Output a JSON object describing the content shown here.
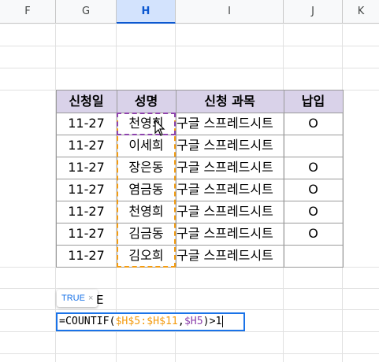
{
  "columns": [
    {
      "letter": "F",
      "selected": false
    },
    {
      "letter": "G",
      "selected": false
    },
    {
      "letter": "H",
      "selected": true
    },
    {
      "letter": "I",
      "selected": false
    },
    {
      "letter": "J",
      "selected": false
    },
    {
      "letter": "K",
      "selected": false
    }
  ],
  "table": {
    "headers": [
      "신청일",
      "성명",
      "신청 과목",
      "납입"
    ],
    "rows": [
      {
        "date": "11-27",
        "name": "천영희",
        "course": "구글 스프레드시트",
        "paid": "O"
      },
      {
        "date": "11-27",
        "name": "이세희",
        "course": "구글 스프레드시트",
        "paid": ""
      },
      {
        "date": "11-27",
        "name": "장은동",
        "course": "구글 스프레드시트",
        "paid": "O"
      },
      {
        "date": "11-27",
        "name": "염금동",
        "course": "구글 스프레드시트",
        "paid": "O"
      },
      {
        "date": "11-27",
        "name": "천영희",
        "course": "구글 스프레드시트",
        "paid": "O"
      },
      {
        "date": "11-27",
        "name": "김금동",
        "course": "구글 스프레드시트",
        "paid": "O"
      },
      {
        "date": "11-27",
        "name": "김오희",
        "course": "구글 스프레드시트",
        "paid": ""
      }
    ]
  },
  "formula": {
    "hint_value": "TRUE",
    "hint_close": "×",
    "cell_text": "E",
    "prefix": "=COUNTIF(",
    "range1": "$H$5:$H$11",
    "comma": ",",
    "range2": "$H5",
    "suffix": ")>1"
  },
  "colors": {
    "header_fill": "#d9d2e9",
    "selected_column": "#d3e3fd",
    "range1_color": "#f39c12",
    "range2_color": "#8e44ad",
    "editor_border": "#1a73e8"
  },
  "icons": {
    "cursor": "pointer-cursor-icon"
  }
}
